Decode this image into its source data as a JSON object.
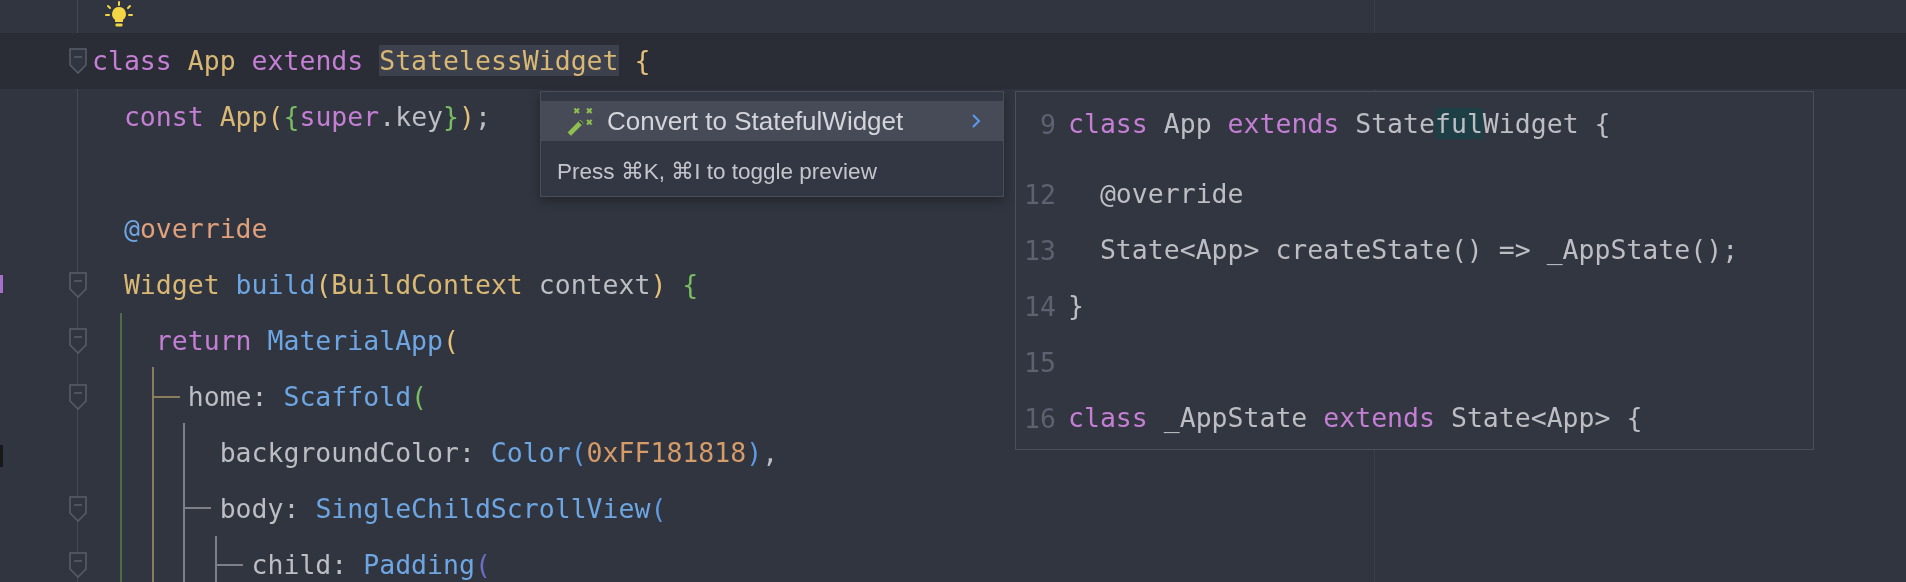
{
  "editor": {
    "intention_bulb": true,
    "lines": [
      {
        "fold": true,
        "current": true,
        "tokens": [
          {
            "text": "class",
            "kind": "kw"
          },
          {
            "text": " App",
            "kind": "type"
          },
          {
            "text": " extends ",
            "kind": "kw"
          },
          {
            "text": "StatelessWidget",
            "kind": "type-marked"
          },
          {
            "text": " {",
            "kind": "b1"
          }
        ]
      },
      {
        "fold": false,
        "current": false,
        "tokens": [
          {
            "text": "  const",
            "kind": "kw"
          },
          {
            "text": " App",
            "kind": "type"
          },
          {
            "text": "(",
            "kind": "b1"
          },
          {
            "text": "{",
            "kind": "b2"
          },
          {
            "text": "super",
            "kind": "kw"
          },
          {
            "text": ".key",
            "kind": "plain"
          },
          {
            "text": "}",
            "kind": "b2"
          },
          {
            "text": ")",
            "kind": "b1"
          },
          {
            "text": ";",
            "kind": "plain"
          }
        ]
      },
      {
        "fold": false,
        "current": false
      },
      {
        "fold": false,
        "current": false,
        "tokens": [
          {
            "text": "  @",
            "kind": "at"
          },
          {
            "text": "override",
            "kind": "annot"
          }
        ]
      },
      {
        "fold": true,
        "current": false,
        "tokens": [
          {
            "text": "  Widget",
            "kind": "type"
          },
          {
            "text": " build",
            "kind": "fn"
          },
          {
            "text": "(",
            "kind": "b1"
          },
          {
            "text": "BuildContext",
            "kind": "type"
          },
          {
            "text": " context",
            "kind": "plain"
          },
          {
            "text": ")",
            "kind": "b1"
          },
          {
            "text": " {",
            "kind": "b2"
          }
        ]
      },
      {
        "fold": true,
        "current": false,
        "tokens": [
          {
            "text": "    return",
            "kind": "kw"
          },
          {
            "text": " MaterialApp",
            "kind": "fn"
          },
          {
            "text": "(",
            "kind": "b1"
          }
        ]
      },
      {
        "fold": true,
        "current": false,
        "tokens": [
          {
            "text": "      home: ",
            "kind": "plain"
          },
          {
            "text": "Scaffold",
            "kind": "fn"
          },
          {
            "text": "(",
            "kind": "b2"
          }
        ]
      },
      {
        "fold": false,
        "current": false,
        "tokens": [
          {
            "text": "        backgroundColor: ",
            "kind": "plain"
          },
          {
            "text": "Color",
            "kind": "fn"
          },
          {
            "text": "(",
            "kind": "b3"
          },
          {
            "text": "0xFF181818",
            "kind": "num"
          },
          {
            "text": ")",
            "kind": "b3"
          },
          {
            "text": ",",
            "kind": "plain"
          }
        ]
      },
      {
        "fold": true,
        "current": false,
        "tokens": [
          {
            "text": "        body: ",
            "kind": "plain"
          },
          {
            "text": "SingleChildScrollView",
            "kind": "fn"
          },
          {
            "text": "(",
            "kind": "b3"
          }
        ]
      },
      {
        "fold": true,
        "current": false,
        "tokens": [
          {
            "text": "          child: ",
            "kind": "plain"
          },
          {
            "text": "Padding",
            "kind": "fn"
          },
          {
            "text": "(",
            "kind": "b4"
          }
        ]
      }
    ]
  },
  "intention_popup": {
    "items": [
      {
        "label": "Convert to StatefulWidget",
        "selected": true
      }
    ],
    "hint": "Press ⌘K, ⌘I to toggle preview"
  },
  "preview": {
    "lines": [
      {
        "number": "9",
        "tokens": [
          {
            "text": "class",
            "kind": "kw"
          },
          {
            "text": " App",
            "kind": "plain"
          },
          {
            "text": " extends",
            "kind": "kw"
          },
          {
            "text": " State",
            "kind": "plain"
          },
          {
            "text": "ful",
            "kind": "marked"
          },
          {
            "text": "Widget {",
            "kind": "plain"
          }
        ]
      },
      {
        "number": "12",
        "tokens": [
          {
            "text": "  @override",
            "kind": "plain"
          }
        ]
      },
      {
        "number": "13",
        "tokens": [
          {
            "text": "  State<App> createState() => _AppState();",
            "kind": "plain"
          }
        ]
      },
      {
        "number": "14",
        "tokens": [
          {
            "text": "}",
            "kind": "plain"
          }
        ]
      },
      {
        "number": "15"
      },
      {
        "number": "16",
        "tokens": [
          {
            "text": "class",
            "kind": "kw"
          },
          {
            "text": " _AppState",
            "kind": "plain"
          },
          {
            "text": " extends",
            "kind": "kw"
          },
          {
            "text": " State<App> {",
            "kind": "plain"
          }
        ]
      }
    ]
  }
}
